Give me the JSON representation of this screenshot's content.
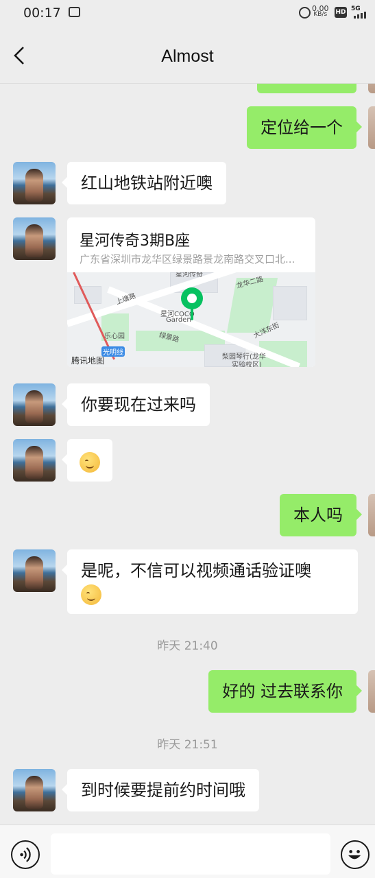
{
  "status": {
    "time": "00:17",
    "net_speed": "0.00",
    "net_unit": "KB/s",
    "hd": "HD",
    "signal": "5G"
  },
  "header": {
    "title": "Almost"
  },
  "messages": {
    "m1": "定位给一个",
    "m2": "红山地铁站附近噢",
    "loc": {
      "name": "星河传奇3期B座",
      "address": "广东省深圳市龙华区绿景路景龙南路交叉口北...",
      "map_labels": {
        "a": "星河传奇",
        "b": "龙华二路",
        "c": "上塘路",
        "d": "星河COCO",
        "e": "Garden",
        "f": "乐心园",
        "g": "绿景路",
        "h": "大洋东街",
        "i": "梨园琴行(龙华",
        "j": "实验校区)",
        "k": "光明线",
        "brand": "腾讯地图"
      }
    },
    "m3": "你要现在过来吗",
    "m4": "本人吗",
    "m5": "是呢，不信可以视频通话验证噢",
    "t1": "昨天 21:40",
    "m6": "好的 过去联系你",
    "t2": "昨天 21:51",
    "m7": "到时候要提前约时间哦"
  },
  "colors": {
    "incoming": "#ffffff",
    "outgoing": "#95ec69",
    "accent": "#07c160",
    "background": "#ededed"
  },
  "icons": [
    "back-arrow-icon",
    "voice-icon",
    "emoji-icon",
    "smile-emoji",
    "thinking-emoji"
  ]
}
